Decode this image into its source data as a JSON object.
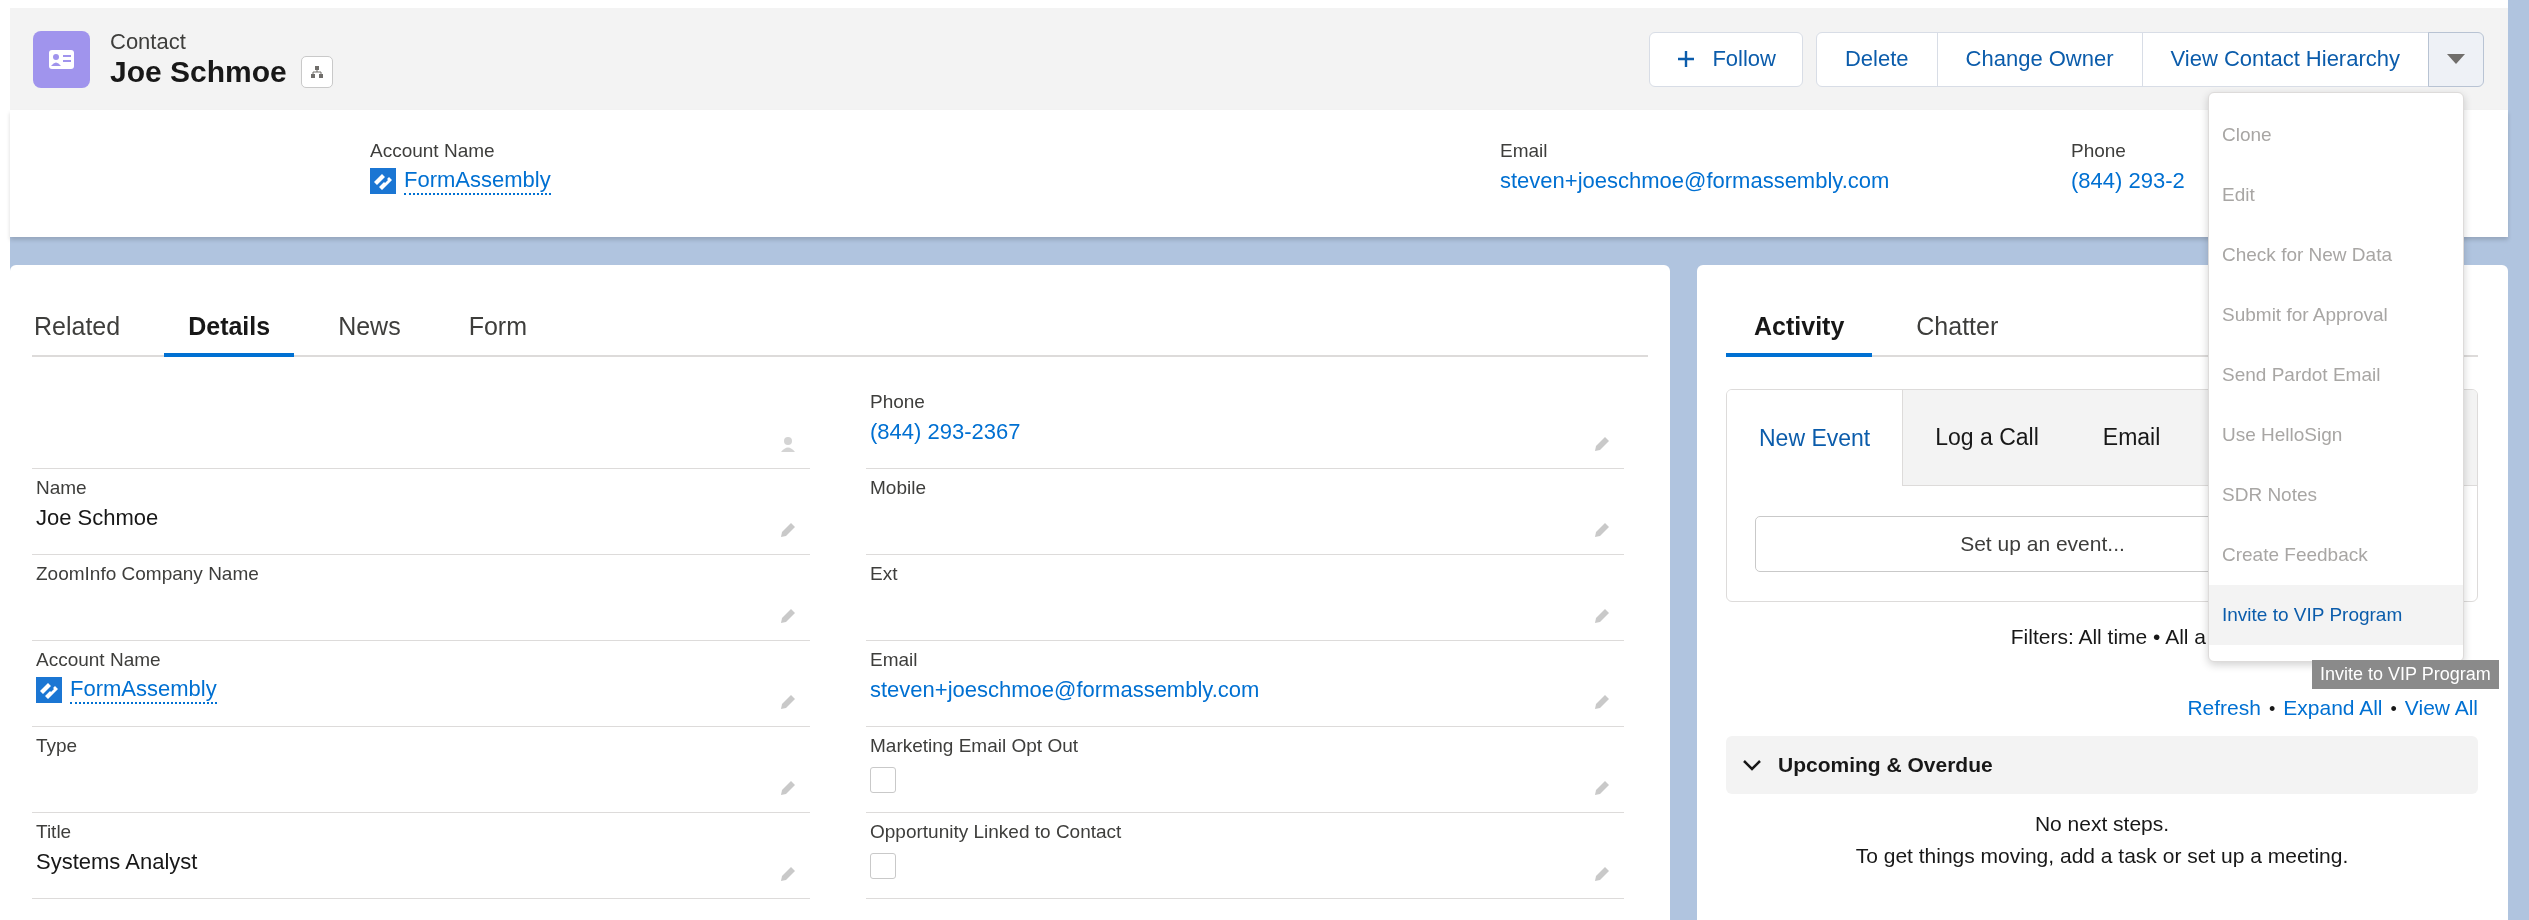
{
  "header": {
    "object_type": "Contact",
    "title": "Joe Schmoe"
  },
  "actions": [
    {
      "label": "Follow",
      "kind": "follow"
    },
    {
      "label": "Delete",
      "kind": "plain"
    },
    {
      "label": "Change Owner",
      "kind": "plain"
    },
    {
      "label": "View Contact Hierarchy",
      "kind": "plain"
    }
  ],
  "more_menu": {
    "expanded": true,
    "tooltip": "Invite to VIP Program",
    "items": [
      {
        "label": "Clone",
        "disabled": true,
        "selected": false
      },
      {
        "label": "Edit",
        "disabled": true,
        "selected": false
      },
      {
        "label": "Check for New Data",
        "disabled": true,
        "selected": false
      },
      {
        "label": "Submit for Approval",
        "disabled": true,
        "selected": false
      },
      {
        "label": "Send Pardot Email",
        "disabled": true,
        "selected": false
      },
      {
        "label": "Use HelloSign",
        "disabled": true,
        "selected": false
      },
      {
        "label": "SDR Notes",
        "disabled": true,
        "selected": false
      },
      {
        "label": "Create Feedback",
        "disabled": true,
        "selected": false
      },
      {
        "label": "Invite to VIP Program",
        "disabled": false,
        "selected": true
      }
    ]
  },
  "highlights": [
    {
      "label": "Account Name",
      "value": "FormAssembly",
      "kind": "account"
    },
    {
      "label": "Email",
      "value": "steven+joeschmoe@formassembly.com",
      "kind": "link"
    },
    {
      "label": "Phone",
      "value": "(844) 293-2",
      "kind": "link"
    }
  ],
  "record_tabs": [
    {
      "label": "Related",
      "selected": false
    },
    {
      "label": "Details",
      "selected": true
    },
    {
      "label": "News",
      "selected": false
    },
    {
      "label": "Form",
      "selected": false
    }
  ],
  "details": {
    "left": [
      {
        "kind": "blank"
      },
      {
        "label": "Name",
        "value": "Joe Schmoe",
        "kind": "text"
      },
      {
        "label": "ZoomInfo Company Name",
        "kind": "text"
      },
      {
        "label": "Account Name",
        "value": "FormAssembly",
        "kind": "account"
      },
      {
        "label": "Type",
        "kind": "text"
      },
      {
        "label": "Title",
        "value": "Systems Analyst",
        "kind": "text"
      }
    ],
    "right": [
      {
        "label": "Phone",
        "value": "(844) 293-2367",
        "kind": "link"
      },
      {
        "label": "Mobile",
        "kind": "text"
      },
      {
        "label": "Ext",
        "kind": "text"
      },
      {
        "label": "Email",
        "value": "steven+joeschmoe@formassembly.com",
        "kind": "link"
      },
      {
        "label": "Marketing Email Opt Out",
        "kind": "checkbox",
        "checked": false
      },
      {
        "label": "Opportunity Linked to Contact",
        "kind": "checkbox",
        "checked": false
      }
    ]
  },
  "activity": {
    "tabs": [
      {
        "label": "Activity",
        "selected": true
      },
      {
        "label": "Chatter",
        "selected": false
      }
    ],
    "composer_tabs": [
      {
        "label": "New Event",
        "selected": true
      },
      {
        "label": "Log a Call",
        "selected": false
      },
      {
        "label": "Email",
        "selected": false
      }
    ],
    "composer_button": "Set up an event...",
    "filters": "Filters: All time • All a",
    "links": [
      "Refresh",
      "Expand All",
      "View All"
    ],
    "separator": "•",
    "section": {
      "title": "Upcoming & Overdue",
      "expanded": true
    },
    "empty_lines": [
      "No next steps.",
      "To get things moving, add a task or set up a meeting."
    ]
  }
}
